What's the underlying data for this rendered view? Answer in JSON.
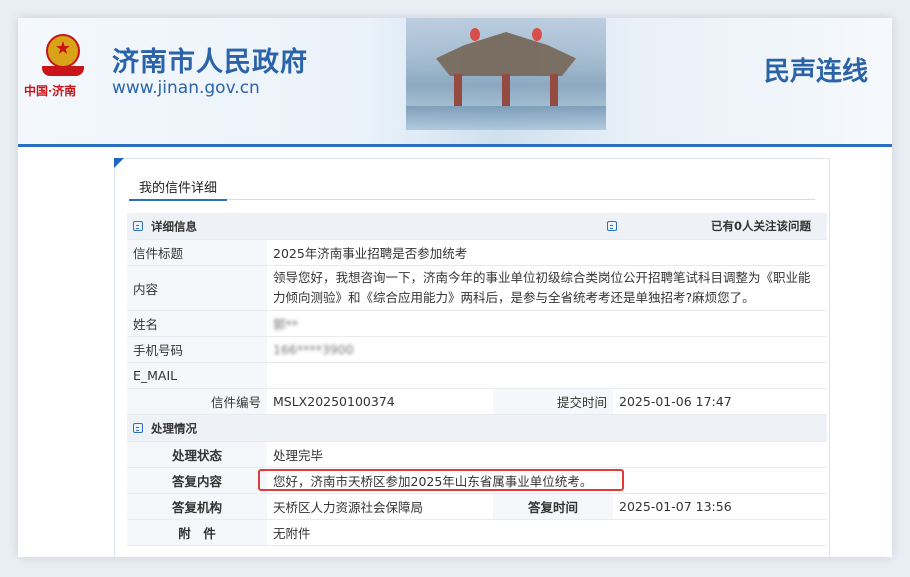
{
  "header": {
    "site_title": "济南市人民政府",
    "site_url": "www.jinan.gov.cn",
    "logo_text": "中国·济南",
    "section_title": "民声连线"
  },
  "tab": {
    "label": "我的信件详细"
  },
  "details": {
    "section_label": "详细信息",
    "follow_text": "已有0人关注该问题",
    "title_label": "信件标题",
    "title_value": "2025年济南事业招聘是否参加统考",
    "content_label": "内容",
    "content_value": "领导您好，我想咨询一下，济南今年的事业单位初级综合类岗位公开招聘笔试科目调整为《职业能力倾向测验》和《综合应用能力》两科后，是参与全省统考考还是单独招考?麻烦您了。",
    "name_label": "姓名",
    "name_value": "郭**",
    "phone_label": "手机号码",
    "phone_value": "166****3900",
    "email_label": "E_MAIL",
    "email_value": "",
    "number_label": "信件编号",
    "number_value": "MSLX20250100374",
    "submit_time_label": "提交时间",
    "submit_time_value": "2025-01-06 17:47"
  },
  "processing": {
    "section_label": "处理情况",
    "status_label": "处理状态",
    "status_value": "处理完毕",
    "reply_label": "答复内容",
    "reply_value": "您好，济南市天桥区参加2025年山东省属事业单位统考。",
    "org_label": "答复机构",
    "org_value": "天桥区人力资源社会保障局",
    "reply_time_label": "答复时间",
    "reply_time_value": "2025-01-07 13:56",
    "attachment_label": "附　件",
    "attachment_value": "无附件"
  },
  "colors": {
    "brand_blue": "#2a63a8",
    "highlight_red": "#e23b3b",
    "emblem_red": "#c9141a"
  }
}
